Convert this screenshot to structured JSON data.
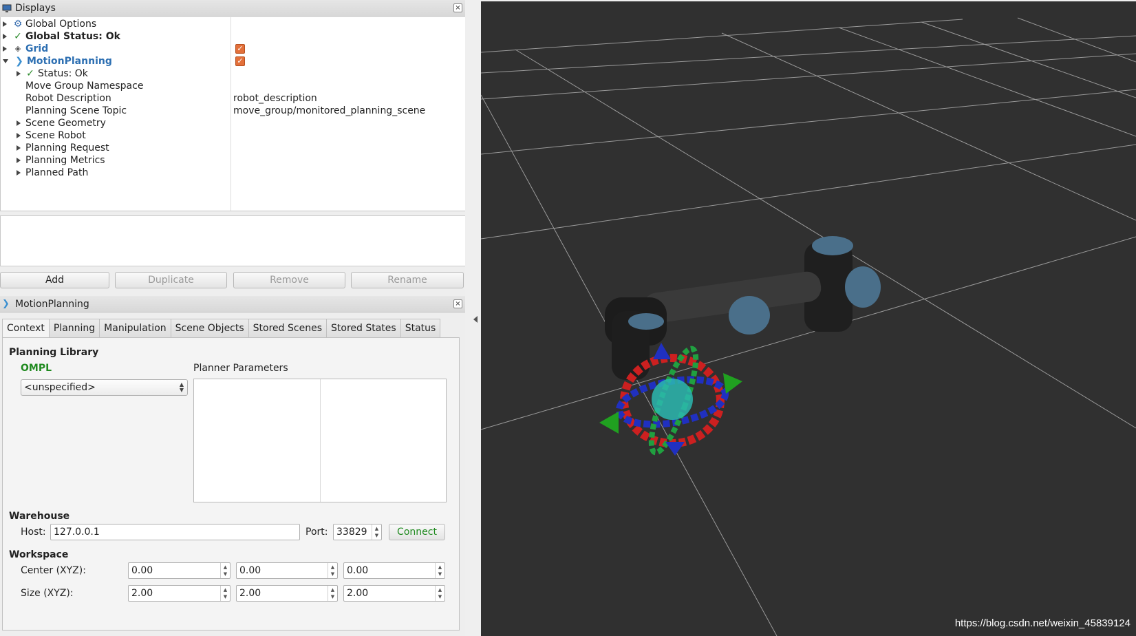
{
  "displays_panel": {
    "title": "Displays",
    "close": "×",
    "rows": [
      {
        "label": "Global Options",
        "value": ""
      },
      {
        "label": "Global Status: Ok",
        "value": ""
      },
      {
        "label": "Grid",
        "checked": true
      },
      {
        "label": "MotionPlanning",
        "checked": true
      },
      {
        "label": "Status: Ok",
        "value": ""
      },
      {
        "label": "Move Group Namespace",
        "value": ""
      },
      {
        "label": "Robot Description",
        "value": "robot_description"
      },
      {
        "label": "Planning Scene Topic",
        "value": "move_group/monitored_planning_scene"
      },
      {
        "label": "Scene Geometry",
        "value": ""
      },
      {
        "label": "Scene Robot",
        "value": ""
      },
      {
        "label": "Planning Request",
        "value": ""
      },
      {
        "label": "Planning Metrics",
        "value": ""
      },
      {
        "label": "Planned Path",
        "value": ""
      }
    ],
    "buttons": {
      "add": "Add",
      "duplicate": "Duplicate",
      "remove": "Remove",
      "rename": "Rename"
    }
  },
  "motion_panel": {
    "title": "MotionPlanning",
    "tabs": [
      "Context",
      "Planning",
      "Manipulation",
      "Scene Objects",
      "Stored Scenes",
      "Stored States",
      "Status"
    ],
    "active_tab": "Context",
    "planning_library": {
      "heading": "Planning Library",
      "library": "OMPL",
      "planner": "<unspecified>",
      "params_label": "Planner Parameters"
    },
    "warehouse": {
      "heading": "Warehouse",
      "host_label": "Host:",
      "host": "127.0.0.1",
      "port_label": "Port:",
      "port": "33829",
      "connect": "Connect"
    },
    "workspace": {
      "heading": "Workspace",
      "center_label": "Center (XYZ):",
      "center": [
        "0.00",
        "0.00",
        "0.00"
      ],
      "size_label": "Size (XYZ):",
      "size": [
        "2.00",
        "2.00",
        "2.00"
      ]
    }
  },
  "viewport": {
    "watermark": "https://blog.csdn.net/weixin_45839124",
    "background": "#303030",
    "grid_color": "#a0a0a0"
  },
  "colors": {
    "checkbox": "#e3703a",
    "link_blue": "#2d6fb2",
    "ok_green": "#2a8a2a"
  }
}
